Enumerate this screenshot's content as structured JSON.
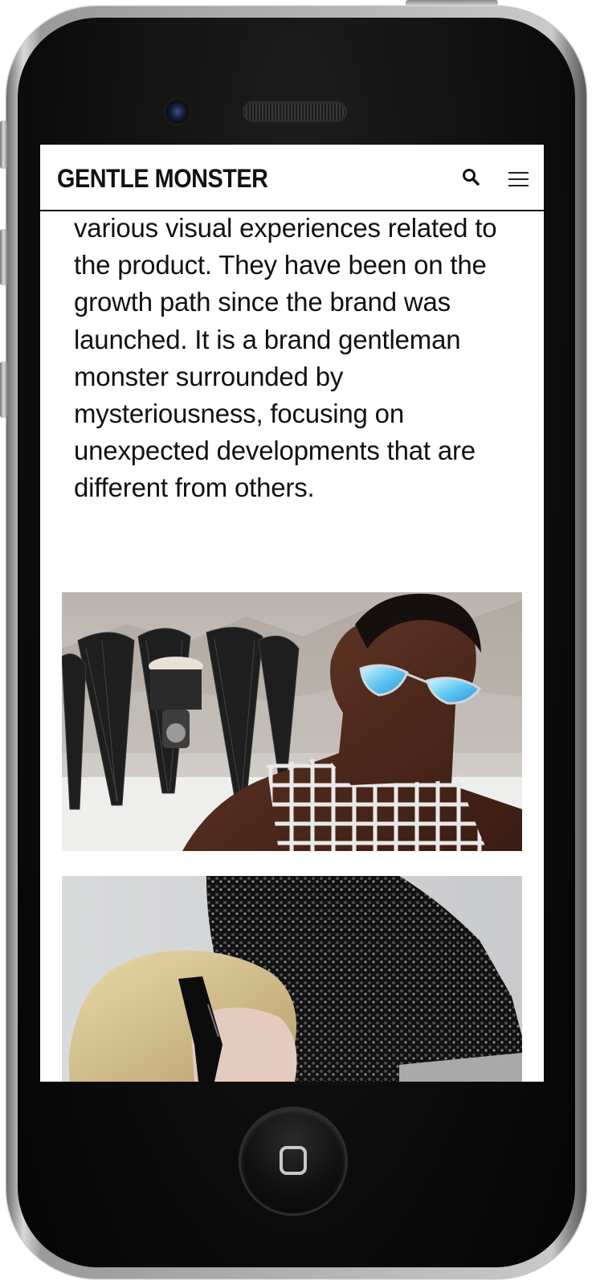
{
  "header": {
    "logo_text": "GENTLE MONSTER",
    "search_icon": "search-icon",
    "menu_icon": "hamburger-menu-icon"
  },
  "main": {
    "about_text": "various visual experiences related to the product. They have been on the growth path since the brand was launched. It is a brand gentleman monster surrounded by mysteriousness, focusing on unexpected developments that are different from others."
  },
  "colors": {
    "text": "#111111",
    "background": "#ffffff",
    "header_border": "#111111",
    "device_frame": "#0b0b0b"
  }
}
